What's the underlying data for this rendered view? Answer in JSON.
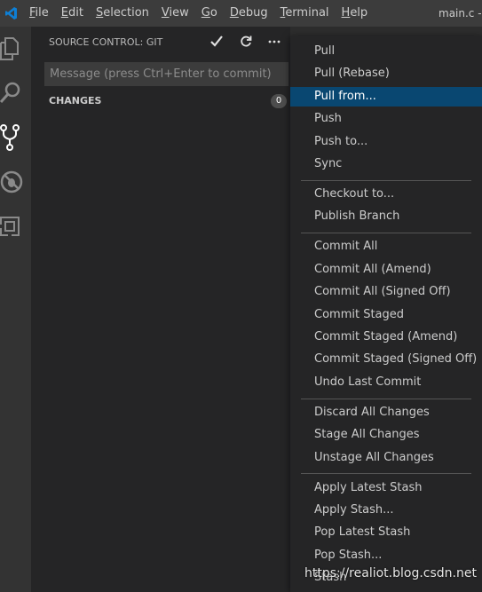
{
  "titlebar": {
    "menu": [
      {
        "mnemonic": "F",
        "rest": "ile"
      },
      {
        "mnemonic": "E",
        "rest": "dit"
      },
      {
        "mnemonic": "S",
        "rest": "election"
      },
      {
        "mnemonic": "V",
        "rest": "iew"
      },
      {
        "mnemonic": "G",
        "rest": "o"
      },
      {
        "mnemonic": "D",
        "rest": "ebug"
      },
      {
        "mnemonic": "T",
        "rest": "erminal"
      },
      {
        "mnemonic": "H",
        "rest": "elp"
      }
    ],
    "window_title": "main.c - t"
  },
  "activitybar": {
    "icons": [
      "files-icon",
      "search-icon",
      "source-control-icon",
      "debug-icon",
      "extensions-icon"
    ]
  },
  "sidebar": {
    "title": "SOURCE CONTROL: GIT",
    "commit_placeholder": "Message (press Ctrl+Enter to commit)",
    "changes_label": "CHANGES",
    "changes_count": "0"
  },
  "context_menu": {
    "groups": [
      [
        "Pull",
        "Pull (Rebase)",
        "Pull from...",
        "Push",
        "Push to...",
        "Sync"
      ],
      [
        "Checkout to...",
        "Publish Branch"
      ],
      [
        "Commit All",
        "Commit All (Amend)",
        "Commit All (Signed Off)",
        "Commit Staged",
        "Commit Staged (Amend)",
        "Commit Staged (Signed Off)",
        "Undo Last Commit"
      ],
      [
        "Discard All Changes",
        "Stage All Changes",
        "Unstage All Changes"
      ],
      [
        "Apply Latest Stash",
        "Apply Stash...",
        "Pop Latest Stash",
        "Pop Stash...",
        "Stash"
      ]
    ],
    "active_item": "Pull from..."
  },
  "watermark": "https://realiot.blog.csdn.net",
  "colors": {
    "titlebar": "#3c3c3c",
    "activitybar": "#333333",
    "sidebar": "#252526",
    "menu_active": "#094771",
    "vscode_blue": "#0e7fd5"
  }
}
